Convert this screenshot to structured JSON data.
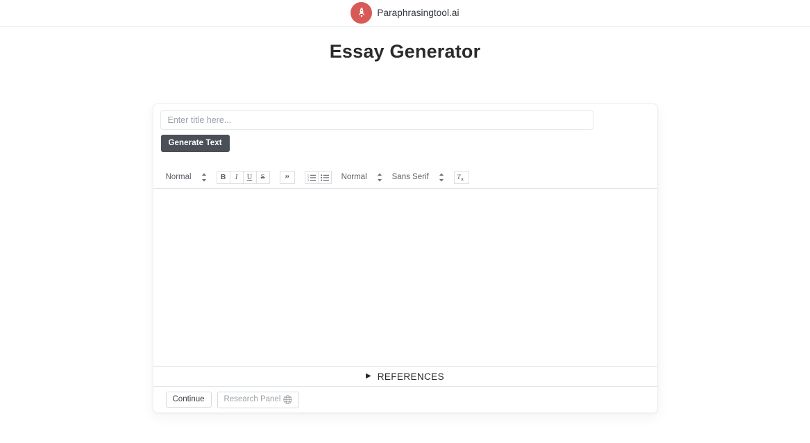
{
  "header": {
    "brand_name": "Paraphrasingtool.ai",
    "brand_icon": "rocket-icon",
    "brand_color": "#d75a57"
  },
  "page": {
    "title": "Essay Generator"
  },
  "editor": {
    "title_input": {
      "value": "",
      "placeholder": "Enter title here..."
    },
    "generate_button": "Generate Text",
    "toolbar": {
      "block_format": "Normal",
      "size_format": "Normal",
      "font_family": "Sans Serif",
      "buttons": [
        {
          "name": "bold-button",
          "label": "B"
        },
        {
          "name": "italic-button",
          "label": "I"
        },
        {
          "name": "underline-button",
          "label": "U"
        },
        {
          "name": "strikethrough-button",
          "label": "S"
        },
        {
          "name": "blockquote-button",
          "label": "”"
        },
        {
          "name": "ordered-list-button",
          "label": ""
        },
        {
          "name": "bullet-list-button",
          "label": ""
        },
        {
          "name": "clear-format-button",
          "label": "Tx"
        }
      ]
    },
    "content": ""
  },
  "references": {
    "arrow": "▶",
    "label": "REFERENCES",
    "expanded": false
  },
  "footer": {
    "continue_label": "Continue",
    "research_panel_label": "Research Panel",
    "research_panel_icon": "globe-icon"
  }
}
